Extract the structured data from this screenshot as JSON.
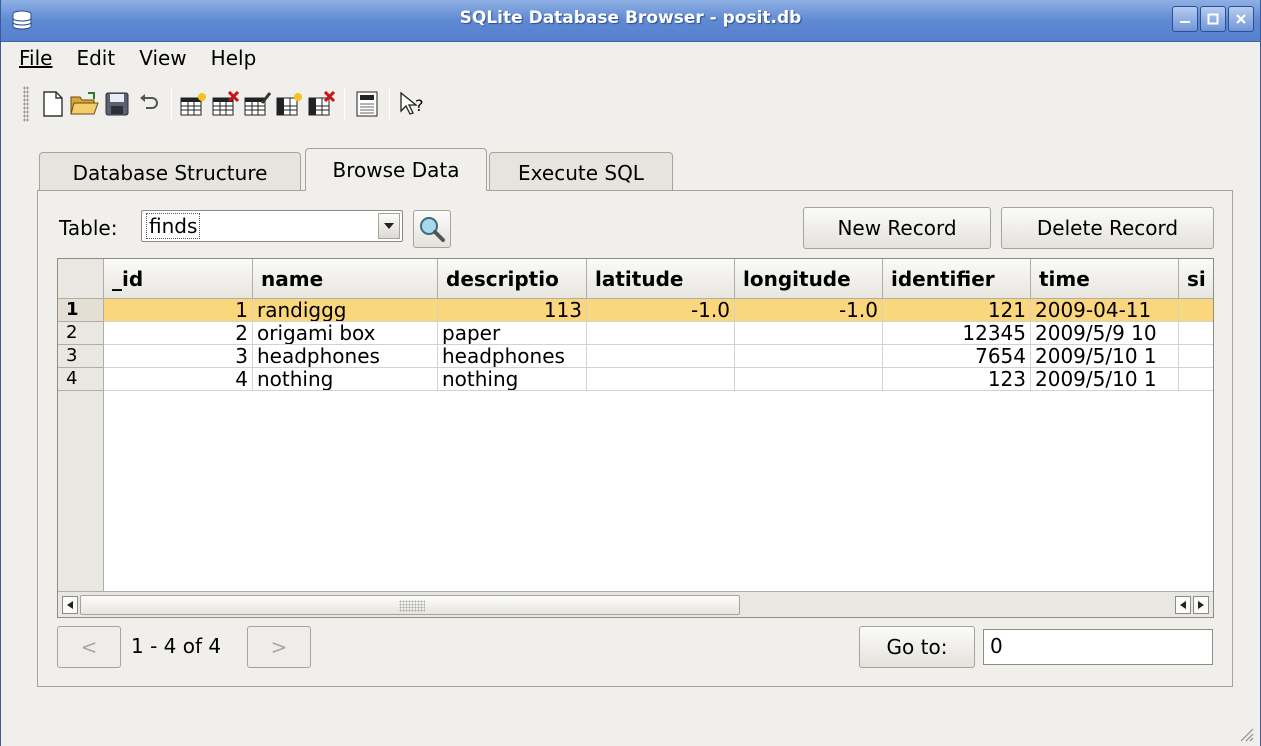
{
  "window": {
    "title": "SQLite Database Browser - posit.db"
  },
  "menu": [
    "File",
    "Edit",
    "View",
    "Help"
  ],
  "toolbar": {
    "icons": [
      "new-database-icon",
      "open-database-icon",
      "save-icon",
      "undo-icon",
      "create-table-icon",
      "delete-table-icon",
      "modify-table-icon",
      "create-index-icon",
      "delete-index-icon",
      "sql-log-icon",
      "whats-this-icon"
    ]
  },
  "tabs": [
    "Database Structure",
    "Browse Data",
    "Execute SQL"
  ],
  "browse": {
    "table_label": "Table:",
    "table_value": "finds",
    "new_record": "New Record",
    "delete_record": "Delete Record",
    "columns": [
      "_id",
      "name",
      "descriptio",
      "latitude",
      "longitude",
      "identifier",
      "time",
      "si"
    ],
    "rows": [
      {
        "num": "1",
        "cells": [
          "1",
          "randiggg",
          "113",
          "-1.0",
          "-1.0",
          "121",
          "2009-04-11",
          ""
        ]
      },
      {
        "num": "2",
        "cells": [
          "2",
          "origami box",
          "paper",
          "",
          "",
          "12345",
          "2009/5/9 10",
          ""
        ]
      },
      {
        "num": "3",
        "cells": [
          "3",
          "headphones",
          "headphones",
          "",
          "",
          "7654",
          "2009/5/10 1",
          ""
        ]
      },
      {
        "num": "4",
        "cells": [
          "4",
          "nothing",
          "nothing",
          "",
          "",
          "123",
          "2009/5/10 1",
          ""
        ]
      }
    ],
    "selected_row": 1,
    "prev_label": "<",
    "next_label": ">",
    "page_info": "1 - 4 of 4",
    "goto_label": "Go to:",
    "goto_value": "0"
  },
  "colors": {
    "titlebar": "#5f89d2",
    "selected_row": "#fad67d",
    "window_bg": "#f0efeb"
  }
}
